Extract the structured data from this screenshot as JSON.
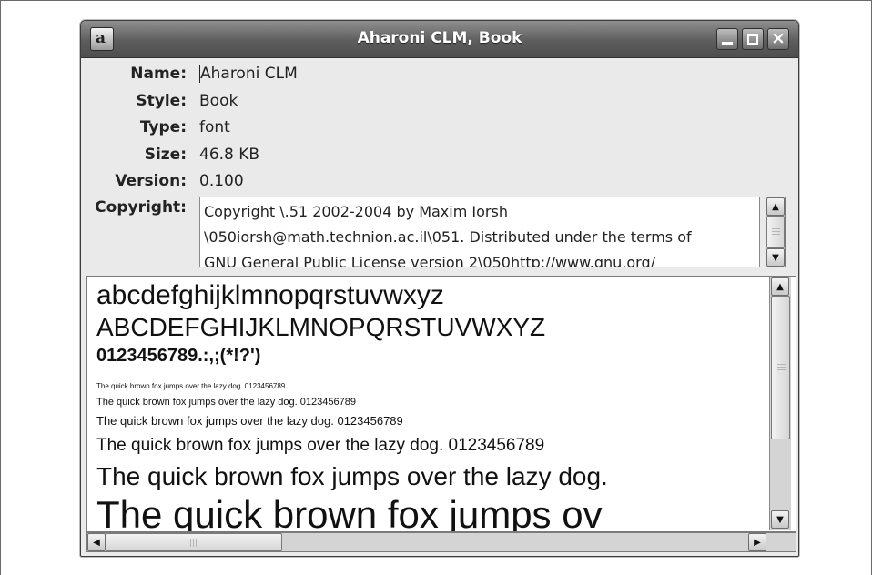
{
  "window": {
    "title": "Aharoni CLM, Book",
    "app_icon": "font-viewer-icon",
    "controls": [
      "minimize-icon",
      "maximize-icon",
      "close-icon"
    ]
  },
  "properties": [
    {
      "label": "Name:",
      "value": "Aharoni CLM"
    },
    {
      "label": "Style:",
      "value": "Book"
    },
    {
      "label": "Type:",
      "value": "font"
    },
    {
      "label": "Size:",
      "value": "46.8 KB"
    },
    {
      "label": "Version:",
      "value": "0.100"
    }
  ],
  "copyright": {
    "label": "Copyright:",
    "lines": [
      "Copyright \\.51 2002-2004 by Maxim Iorsh",
      "\\050iorsh@math.technion.ac.il\\051. Distributed under the terms of",
      "GNU General Public License version 2\\050http://www.gnu.org/"
    ]
  },
  "preview": {
    "lowercase": "abcdefghijklmnopqrstuvwxyz",
    "uppercase": "ABCDEFGHIJKLMNOPQRSTUVWXYZ",
    "digits": "0123456789.:,;(*!?')",
    "samples": [
      "The quick brown fox jumps over the lazy dog. 0123456789",
      "The quick brown fox jumps over the lazy dog. 0123456789",
      "The quick brown fox jumps over the lazy dog. 0123456789",
      "The quick brown fox jumps over the lazy dog. 0123456789",
      "The quick brown fox jumps over the lazy dog.",
      "The quick brown fox jumps ov"
    ]
  },
  "scrollbars": {
    "copyright_vertical": {
      "position": 0.0
    },
    "preview_vertical": {
      "position": 0.0,
      "visible_fraction": 0.7
    },
    "preview_horizontal": {
      "position": 0.0,
      "visible_fraction": 0.29
    }
  }
}
